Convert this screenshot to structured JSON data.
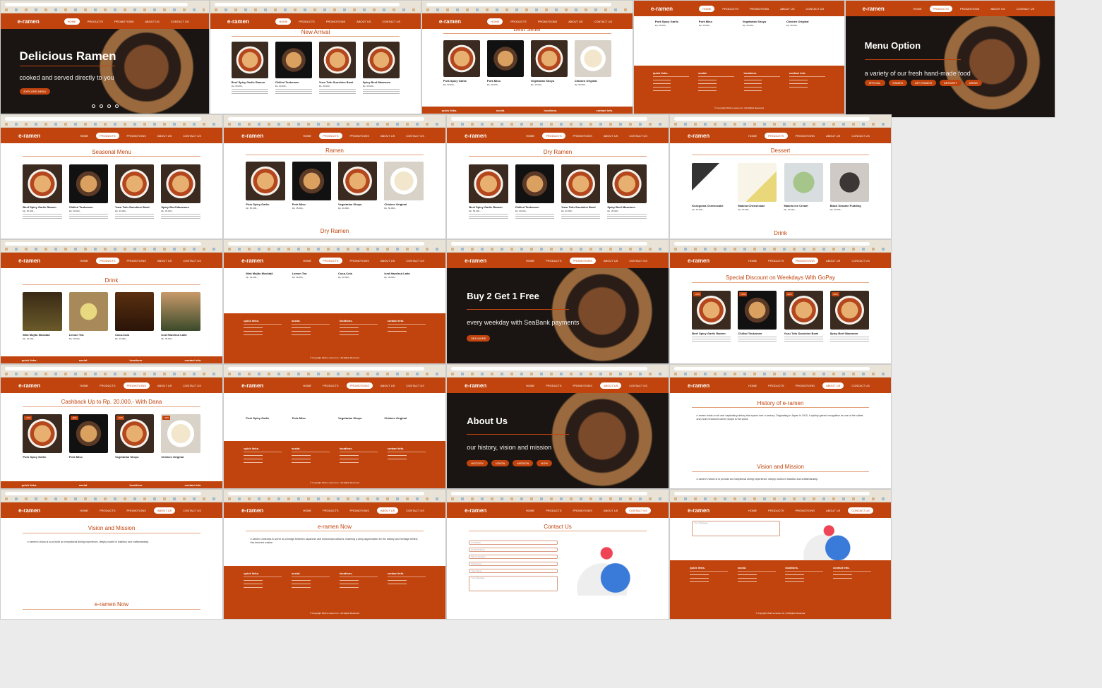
{
  "brand": {
    "logo": "e-ramen",
    "accent": "#c1440e"
  },
  "nav": [
    "HOME",
    "PRODUCTS",
    "PROMOTIONS",
    "ABOUT US",
    "CONTACT US"
  ],
  "hero_home": {
    "title": "Delicious Ramen",
    "subtitle": "cooked and served directly to you",
    "button": "EXPLORE MENU"
  },
  "hero_menu": {
    "title": "Menu Option",
    "subtitle": "a variety of our fresh hand-made food",
    "buttons": [
      "SPECIAL",
      "RAMEN",
      "DRY RAMEN",
      "DESSERT",
      "DRINK"
    ]
  },
  "hero_promo": {
    "title": "Buy 2 Get 1 Free",
    "subtitle": "every weekday with SeaBank payments",
    "button": "SEE MORE"
  },
  "hero_about": {
    "title": "About Us",
    "subtitle": "our history, vision and mission",
    "buttons": [
      "HISTORY",
      "VISION",
      "MISSION",
      "NOW"
    ]
  },
  "sections": {
    "new_arrival": "New Arrival",
    "best_seller": "Best Seller",
    "seasonal": "Seasonal Menu",
    "ramen": "Ramen",
    "dry_ramen": "Dry Ramen",
    "dessert": "Dessert",
    "drink": "Drink",
    "gopay": "Special Discount on Weekdays With GoPay",
    "dana": "Cashback Up to Rp. 20.000,- With Dana",
    "history": "History of e-ramen",
    "vision": "Vision and Mission",
    "now": "e-ramen Now",
    "contact": "Contact Us"
  },
  "items": {
    "seasonal": [
      {
        "name": "Beef Spicy Garlic Ramen",
        "price": "Rp. 50.000,-"
      },
      {
        "name": "Chilled Tsukemen",
        "price": "Rp. 60.000,-"
      },
      {
        "name": "Yuzu Tofu Sunshine Bowl",
        "price": "Rp. 30.000,-"
      },
      {
        "name": "Spicy Beef Mazemen",
        "price": "Rp. 35.000,-"
      }
    ],
    "ramen": [
      {
        "name": "Pork Spicy Garlic",
        "price": "Rp. 50.000,-"
      },
      {
        "name": "Pork Miso",
        "price": "Rp. 35.000,-"
      },
      {
        "name": "Vegetarian Shoyu",
        "price": "Rp. 40.000,-"
      },
      {
        "name": "Chicken Original",
        "price": "Rp. 50.000,-"
      }
    ],
    "dessert": [
      {
        "name": "Kurogoma Cheesecake",
        "price": "Rp. 40.000,-"
      },
      {
        "name": "Matcha Cheesecake",
        "price": "Rp. 40.000,-"
      },
      {
        "name": "Matcha Ice Cream",
        "price": "Rp. 30.000,-"
      },
      {
        "name": "Black Sesame Pudding",
        "price": "Rp. 30.000,-"
      }
    ],
    "drink": [
      {
        "name": "Mint Mojito Mocktail",
        "price": "Rp. 40.000,-"
      },
      {
        "name": "Lemon Tea",
        "price": "Rp. 30.000,-"
      },
      {
        "name": "Coca-Cola",
        "price": "Rp. 20.000,-"
      },
      {
        "name": "Iced Hazelnut Latte",
        "price": "Rp. 35.000,-"
      }
    ]
  },
  "promo_tag": "-20%",
  "footer": {
    "cols": [
      "quick links.",
      "social.",
      "locations.",
      "contact info."
    ],
    "copyright": "© Copyright 2024 e-ramen Inc. | All Rights Reserved"
  },
  "about_paras": {
    "history": "e-ramen holds a rich and captivating history that spans over a century. Originating in Japan in 1910, it quickly gained recognition as one of the oldest and most renowned ramen shops in the world.",
    "vision": "e-ramen's vision is to provide an exceptional dining experience, deeply rooted in tradition and craftsmanship.",
    "now": "e-ramen continues to serve as a bridge between Japanese and Indonesian cultures, fostering a deep appreciation for the artistry and heritage behind this beloved cuisine."
  },
  "contact_fields": [
    "Full Name",
    "Email Address",
    "Phone Number",
    "Preference",
    "Your Name",
    "Your Message"
  ]
}
